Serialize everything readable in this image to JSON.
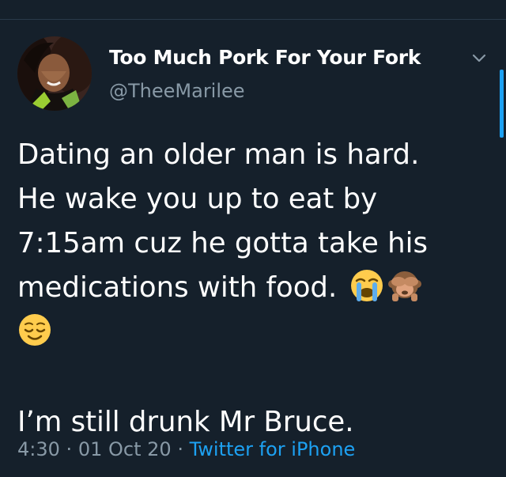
{
  "header": {
    "display_name": "Too Much Pork For Your Fork",
    "handle": "@TheeMarilee"
  },
  "tweet": {
    "lines": [
      "Dating an older man is hard.",
      "He wake you up to eat by",
      "7:15am cuz he gotta take his",
      "medications with food."
    ],
    "second_paragraph": "I’m still drunk Mr Bruce.",
    "emojis": [
      "loudly-crying-face-emoji",
      "see-no-evil-monkey-emoji",
      "relieved-face-emoji"
    ]
  },
  "meta": {
    "time": "4:30",
    "separator": "·",
    "date": "01 Oct 20",
    "source": "Twitter for iPhone"
  },
  "colors": {
    "background": "#15202b",
    "text_primary": "#ffffff",
    "text_secondary": "#8899a6",
    "accent": "#1da1f2"
  }
}
